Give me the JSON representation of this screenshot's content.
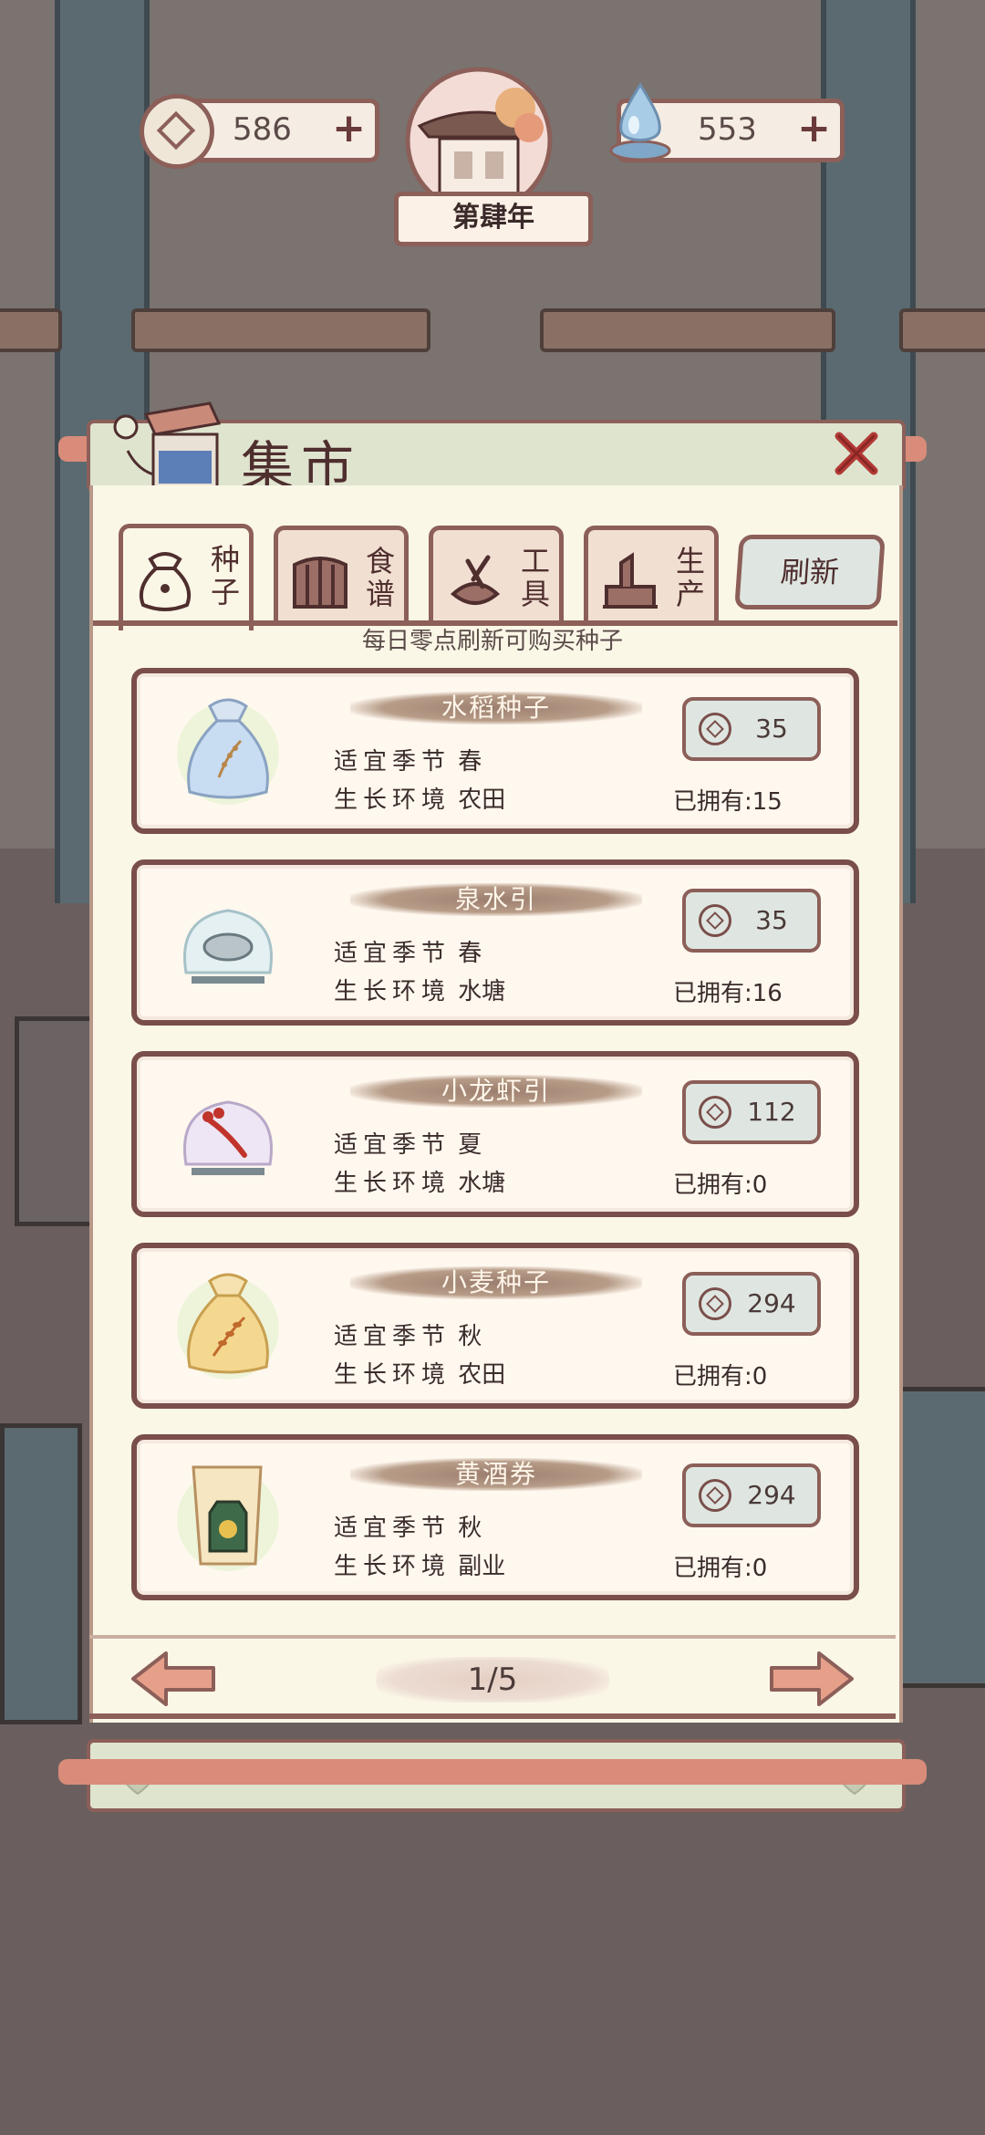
{
  "hud": {
    "coins": "586",
    "spirit": "553",
    "plus": "+",
    "year": "第肆年"
  },
  "market": {
    "title": "集市",
    "tabs": [
      {
        "label": "种子",
        "icon": "seed-bag-icon",
        "active": true
      },
      {
        "label": "食谱",
        "icon": "recipe-book-icon",
        "active": false
      },
      {
        "label": "工具",
        "icon": "tools-icon",
        "active": false
      },
      {
        "label": "生产",
        "icon": "production-icon",
        "active": false
      }
    ],
    "refresh_label": "刷新",
    "subtitle": "每日零点刷新可购买种子",
    "items": [
      {
        "name": "水稻种子",
        "season_label": "适宜季节",
        "season": "春",
        "env_label": "生长环境",
        "env": "农田",
        "price": "35",
        "owned": "已拥有:15",
        "icon": "rice-seed-bag-icon"
      },
      {
        "name": "泉水引",
        "season_label": "适宜季节",
        "season": "春",
        "env_label": "生长环境",
        "env": "水塘",
        "price": "35",
        "owned": "已拥有:16",
        "icon": "water-bowl-icon"
      },
      {
        "name": "小龙虾引",
        "season_label": "适宜季节",
        "season": "夏",
        "env_label": "生长环境",
        "env": "水塘",
        "price": "112",
        "owned": "已拥有:0",
        "icon": "crayfish-bowl-icon"
      },
      {
        "name": "小麦种子",
        "season_label": "适宜季节",
        "season": "秋",
        "env_label": "生长环境",
        "env": "农田",
        "price": "294",
        "owned": "已拥有:0",
        "icon": "wheat-seed-bag-icon"
      },
      {
        "name": "黄酒券",
        "season_label": "适宜季节",
        "season": "秋",
        "env_label": "生长环境",
        "env": "副业",
        "price": "294",
        "owned": "已拥有:0",
        "icon": "wine-ticket-icon"
      }
    ],
    "page": "1/5"
  },
  "colors": {
    "border": "#8c5f59",
    "parchment": "#fbf7e7",
    "panel_green": "#dfe4cf",
    "background": "#6b625f"
  }
}
